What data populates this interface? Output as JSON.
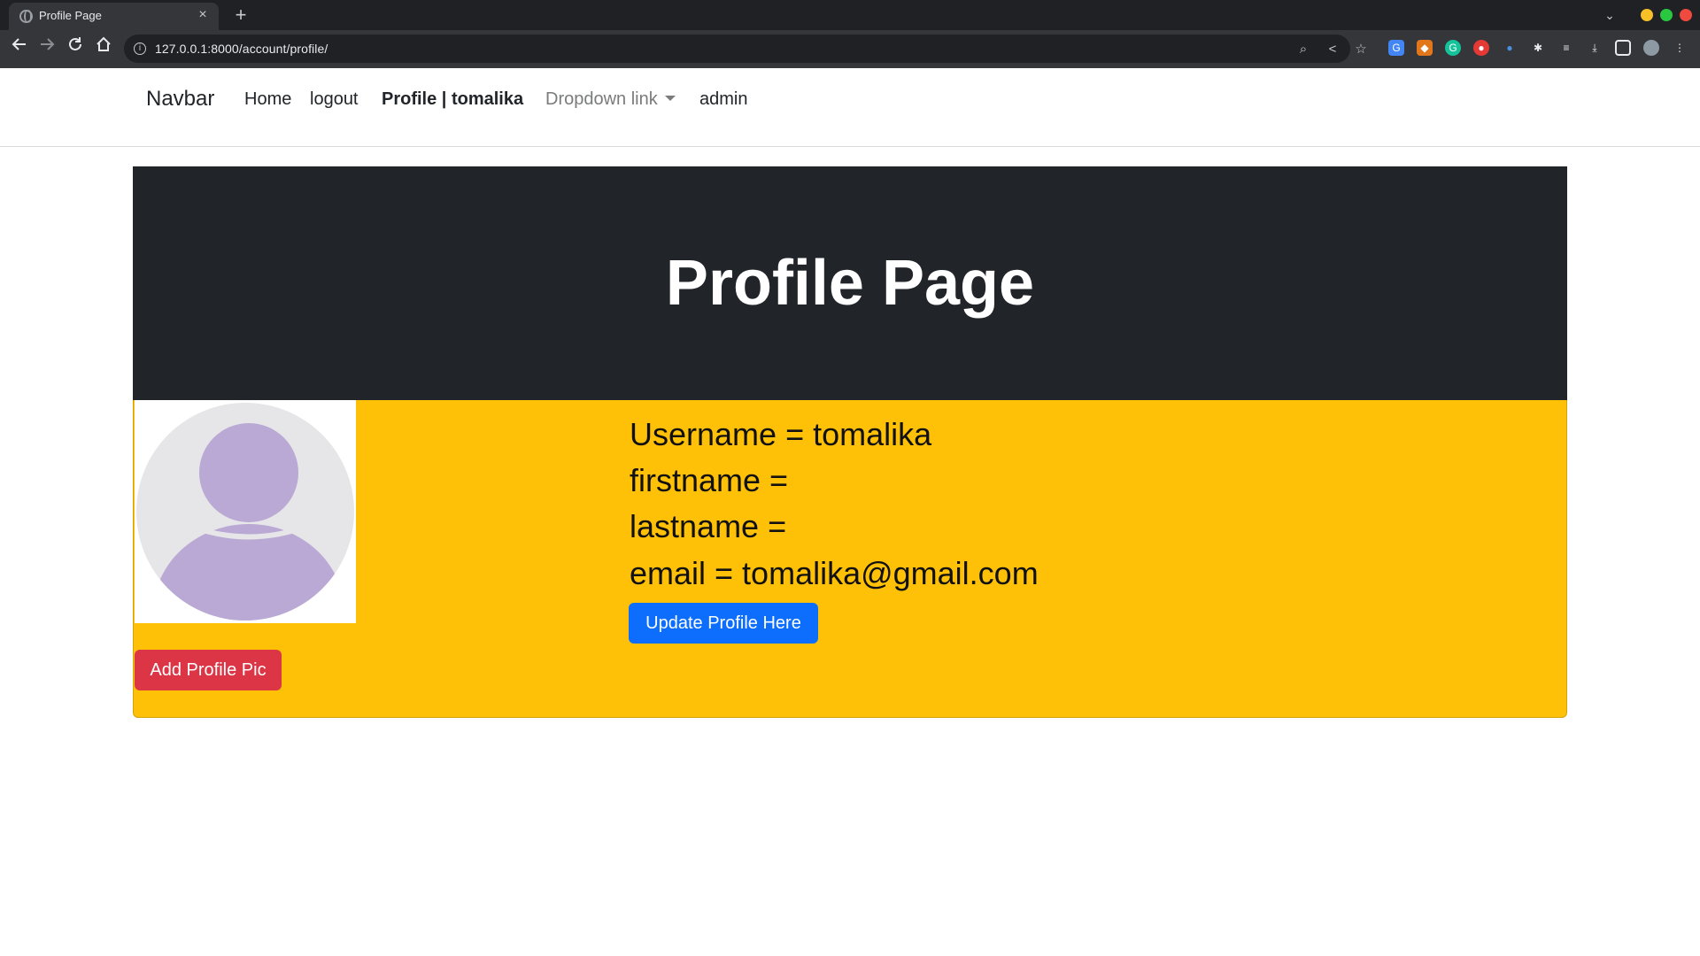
{
  "browser": {
    "tab_title": "Profile Page",
    "tab_close": "×",
    "new_tab": "+",
    "url": "127.0.0.1:8000/account/profile/",
    "window_controls": {
      "minimize_color": "#f6c026",
      "maximize_color": "#2ac840",
      "close_color": "#ef4a3f"
    }
  },
  "navbar": {
    "brand": "Navbar",
    "links": [
      "Home",
      "logout",
      "Profile | tomalika",
      "Dropdown link",
      "admin"
    ]
  },
  "hero": {
    "title": "Profile Page",
    "background": "#212529"
  },
  "profile": {
    "username_line": "Username = tomalika",
    "firstname_line": "firstname =",
    "lastname_line": "lastname =",
    "email_line": "email = tomalika@gmail.com",
    "update_button": "Update Profile Here",
    "add_pic_button": "Add Profile Pic",
    "avatar": "default-avatar-icon",
    "card_color": "#ffc107"
  }
}
